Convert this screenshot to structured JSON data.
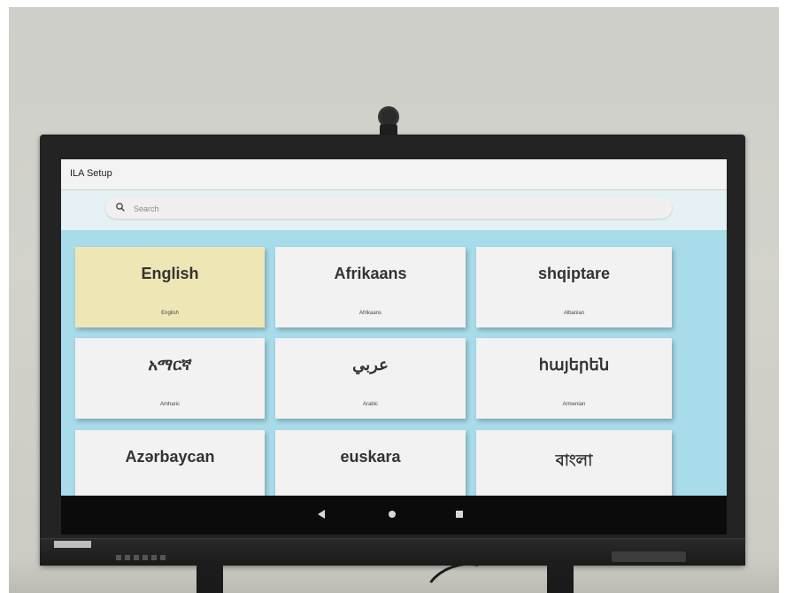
{
  "app": {
    "title": "ILA Setup"
  },
  "search": {
    "placeholder": "Search",
    "value": ""
  },
  "languages": [
    {
      "native": "English",
      "english": "English",
      "selected": true
    },
    {
      "native": "Afrikaans",
      "english": "Afrikaans",
      "selected": false
    },
    {
      "native": "shqiptare",
      "english": "Albanian",
      "selected": false
    },
    {
      "native": "አማርኛ",
      "english": "Amharic",
      "selected": false
    },
    {
      "native": "عربي",
      "english": "Arabic",
      "selected": false
    },
    {
      "native": "հայերեն",
      "english": "Armenian",
      "selected": false
    },
    {
      "native": "Azərbaycan",
      "english": "",
      "selected": false
    },
    {
      "native": "euskara",
      "english": "",
      "selected": false
    },
    {
      "native": "বাংলা",
      "english": "",
      "selected": false
    }
  ],
  "colors": {
    "content_background": "#a8dcea",
    "selected_tile": "#efe6b6",
    "tile": "#f2f2f2",
    "titlebar": "#f3f3f3"
  },
  "icons": {
    "search": "search-icon",
    "nav_back": "back-triangle-icon",
    "nav_home": "home-circle-icon",
    "nav_recent": "recent-apps-square-icon"
  }
}
